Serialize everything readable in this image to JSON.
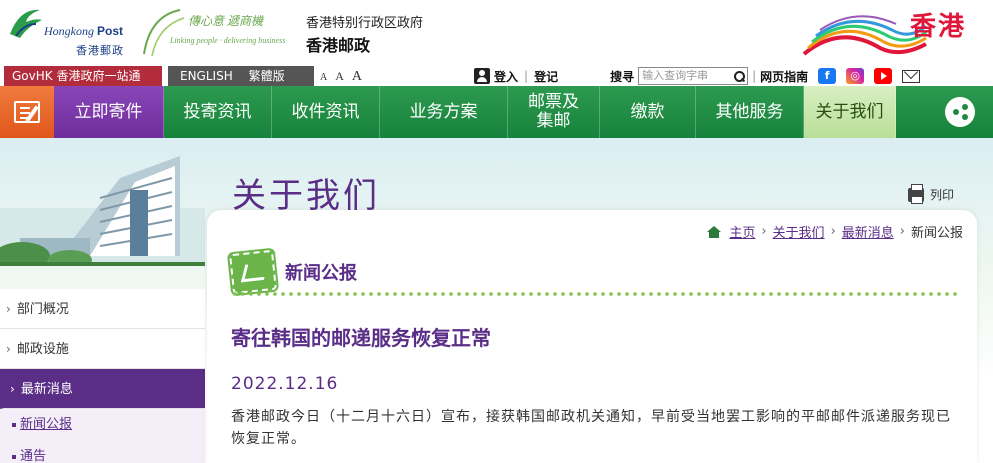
{
  "header": {
    "logo_en_1": "Hongkong",
    "logo_en_2": "Post",
    "logo_cn": "香港郵政",
    "slogan_cn": "傳心意 遞商機",
    "slogan_en": "Linking people · delivering business",
    "gov_title": "香港特别行政区政府",
    "dept_title": "香港邮政",
    "brand_hk": "香港"
  },
  "utility": {
    "govhk": "GovHK 香港政府一站通",
    "english": "ENGLISH",
    "traditional": "繁體版",
    "font_small": "A",
    "font_medium": "A",
    "font_large": "A",
    "login": "登入",
    "register": "登记",
    "search_label": "搜寻",
    "search_placeholder": "输入查询字串",
    "web_guide": "网页指南"
  },
  "nav": {
    "items": [
      {
        "label": "立即寄件"
      },
      {
        "label": "投寄资讯"
      },
      {
        "label": "收件资讯"
      },
      {
        "label": "业务方案"
      },
      {
        "label": "邮票及\n集邮"
      },
      {
        "label": "缴款"
      },
      {
        "label": "其他服务"
      },
      {
        "label": "关于我们"
      }
    ]
  },
  "page": {
    "title": "关于我们",
    "print": "列印"
  },
  "sidebar": {
    "items": [
      {
        "label": "部门概况"
      },
      {
        "label": "邮政设施"
      },
      {
        "label": "最新消息"
      }
    ],
    "sub_items": [
      {
        "label": "新闻公报"
      },
      {
        "label": "通告"
      }
    ]
  },
  "breadcrumb": {
    "home": "主页",
    "about": "关于我们",
    "news": "最新消息",
    "current": "新闻公报"
  },
  "section": {
    "title": "新闻公报"
  },
  "article": {
    "headline": "寄往韩国的邮递服务恢复正常",
    "date": "2022.12.16",
    "body": "香港邮政今日（十二月十六日）宣布，接获韩国邮政机关通知，早前受当地罢工影响的平邮邮件派递服务现已恢复正常。"
  },
  "colors": {
    "purple": "#5a2d87",
    "green": "#1c8a40",
    "orange": "#e0571c",
    "govhk_red": "#b22c3c"
  }
}
